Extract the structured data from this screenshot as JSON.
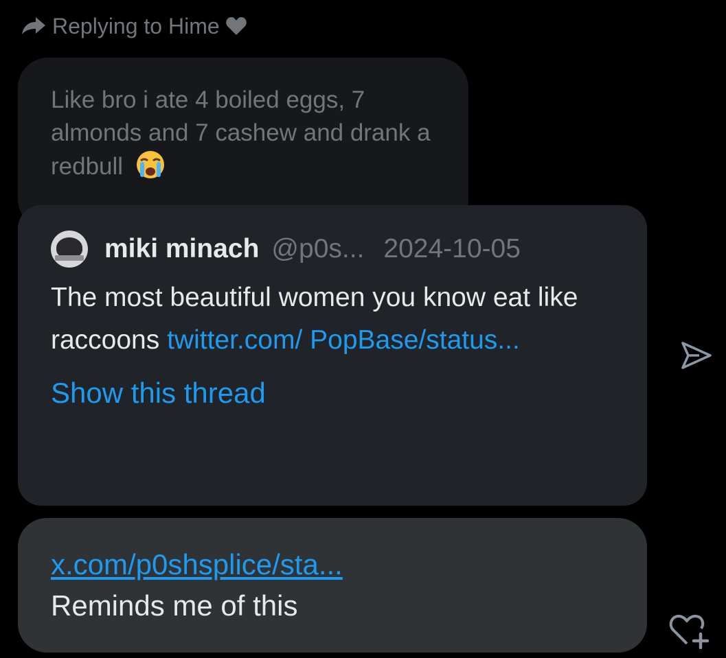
{
  "reply_header": {
    "text": "Replying to Hime",
    "arrow_icon": "reply-arrow-icon",
    "heart_icon": "heart-icon",
    "color": "#71767b"
  },
  "quoted_message": {
    "text": "Like bro i ate 4 boiled eggs, 7 almonds and 7 cashew and drank a redbull",
    "emoji_icon": "loudly-crying-face-emoji"
  },
  "tweet_card": {
    "author_name": "miki minach",
    "author_handle": "@p0s...",
    "date": "2024-10-05",
    "body_text": "The most beautiful women you know eat like raccoons",
    "link_text": "twitter.com/ PopBase/status...",
    "show_thread_label": "Show this thread",
    "link_color": "#1d9bf0"
  },
  "message": {
    "link_text": "x.com/p0shsplice/sta...",
    "text": "Reminds me of this"
  },
  "actions": {
    "send_icon": "send-icon",
    "react_icon": "add-reaction-heart-icon"
  }
}
